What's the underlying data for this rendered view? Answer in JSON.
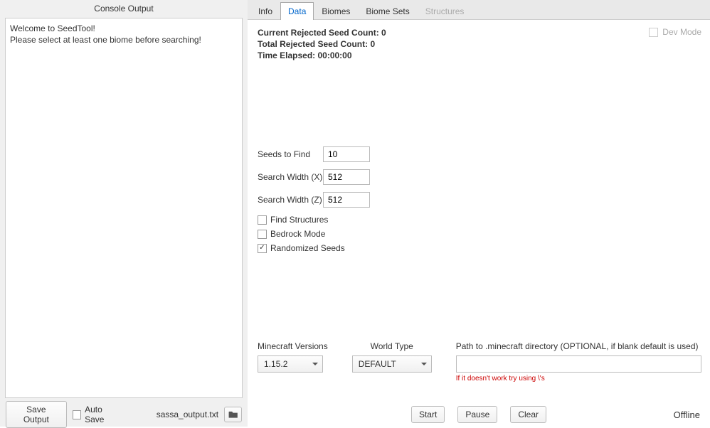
{
  "console": {
    "title": "Console Output",
    "lines": [
      "Welcome to SeedTool!",
      "Please select at least one biome before searching!"
    ]
  },
  "footer_left": {
    "save_output_label": "Save Output",
    "auto_save_label": "Auto Save",
    "auto_save_checked": false,
    "filename": "sassa_output.txt"
  },
  "tabs": [
    {
      "label": "Info",
      "active": false,
      "disabled": false
    },
    {
      "label": "Data",
      "active": true,
      "disabled": false
    },
    {
      "label": "Biomes",
      "active": false,
      "disabled": false
    },
    {
      "label": "Biome Sets",
      "active": false,
      "disabled": false
    },
    {
      "label": "Structures",
      "active": false,
      "disabled": true
    }
  ],
  "stats": {
    "current_rejected_label": "Current Rejected Seed Count:",
    "current_rejected_value": "0",
    "total_rejected_label": "Total Rejected Seed Count:",
    "total_rejected_value": "0",
    "time_elapsed_label": "Time Elapsed:",
    "time_elapsed_value": "00:00:00"
  },
  "dev_mode": {
    "label": "Dev Mode",
    "checked": false
  },
  "form": {
    "seeds_to_find": {
      "label": "Seeds to Find",
      "value": "10"
    },
    "search_width_x": {
      "label": "Search Width (X)",
      "value": "512"
    },
    "search_width_z": {
      "label": "Search Width (Z)",
      "value": "512"
    },
    "find_structures": {
      "label": "Find Structures",
      "checked": false
    },
    "bedrock_mode": {
      "label": "Bedrock Mode",
      "checked": false
    },
    "randomized_seeds": {
      "label": "Randomized Seeds",
      "checked": true
    }
  },
  "bottom": {
    "versions": {
      "label": "Minecraft Versions",
      "value": "1.15.2"
    },
    "world_type": {
      "label": "World Type",
      "value": "DEFAULT"
    },
    "path": {
      "label": "Path to .minecraft directory (OPTIONAL, if blank default is used)",
      "value": "",
      "note": "If it doesn't work try using \\'s"
    }
  },
  "actions": {
    "start": "Start",
    "pause": "Pause",
    "clear": "Clear"
  },
  "status": "Offline"
}
